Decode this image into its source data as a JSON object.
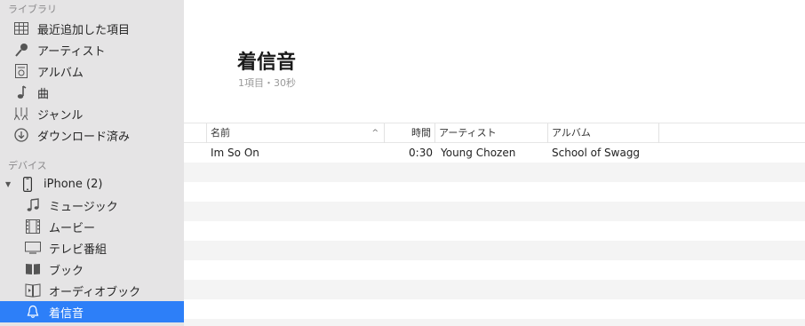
{
  "sidebar": {
    "library_header": "ライブラリ",
    "library_items": [
      {
        "label": "最近追加した項目",
        "icon": "grid-icon"
      },
      {
        "label": "アーティスト",
        "icon": "microphone-icon"
      },
      {
        "label": "アルバム",
        "icon": "album-icon"
      },
      {
        "label": "曲",
        "icon": "music-note-icon"
      },
      {
        "label": "ジャンル",
        "icon": "genre-icon"
      },
      {
        "label": "ダウンロード済み",
        "icon": "download-icon"
      }
    ],
    "devices_header": "デバイス",
    "device": {
      "label": "iPhone (2)",
      "icon": "iphone-icon"
    },
    "device_items": [
      {
        "label": "ミュージック",
        "icon": "music-icon"
      },
      {
        "label": "ムービー",
        "icon": "film-icon"
      },
      {
        "label": "テレビ番組",
        "icon": "tv-icon"
      },
      {
        "label": "ブック",
        "icon": "book-icon"
      },
      {
        "label": "オーディオブック",
        "icon": "audiobook-icon"
      },
      {
        "label": "着信音",
        "icon": "bell-icon",
        "selected": true
      }
    ]
  },
  "main": {
    "title": "着信音",
    "subtitle": "1項目・30秒",
    "columns": {
      "name": "名前",
      "time": "時間",
      "artist": "アーティスト",
      "album": "アルバム"
    },
    "rows": [
      {
        "name": "Im So On",
        "time": "0:30",
        "artist": "Young Chozen",
        "album": "School of Swagg"
      }
    ]
  },
  "colors": {
    "sidebar_bg": "#e5e4e5",
    "selection": "#2d7ff8",
    "alt_row": "#f4f4f4"
  }
}
